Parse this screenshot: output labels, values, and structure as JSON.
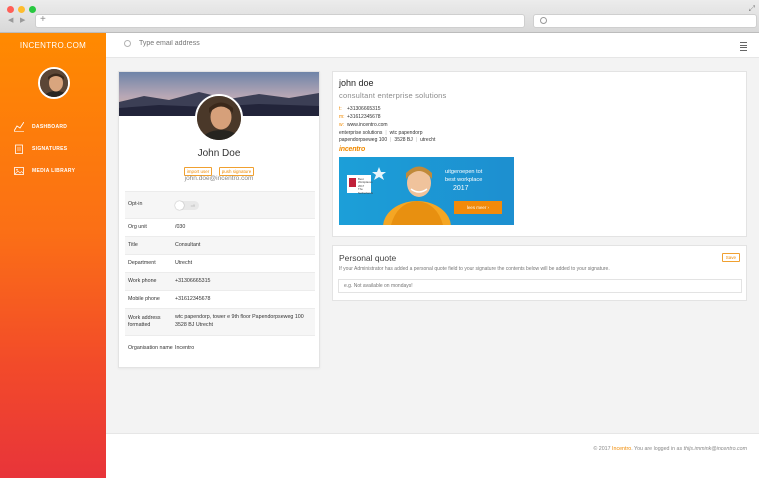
{
  "browser": {
    "back_glyph": "◀",
    "forward_glyph": "▶",
    "new_tab_glyph": "+",
    "expand_glyph": "⤢"
  },
  "sidebar": {
    "brand": "INCENTRO.COM",
    "items": [
      {
        "label": "DASHBOARD",
        "icon": "chart-line-icon"
      },
      {
        "label": "SIGNATURES",
        "icon": "clipboard-icon"
      },
      {
        "label": "MEDIA LIBRARY",
        "icon": "image-icon"
      }
    ],
    "gradient": [
      "#ff8a00",
      "#e8343a"
    ]
  },
  "topbar": {
    "search_placeholder": "Type email address",
    "menu_icon": "list-icon"
  },
  "profile": {
    "name": "John Doe",
    "tags": [
      "import user",
      "push signature"
    ],
    "email": "john.doe@incentro.com",
    "optin_label": "Opt-in",
    "optin_state": "off",
    "fields": [
      {
        "label": "Org unit",
        "value": "/030"
      },
      {
        "label": "Title",
        "value": "Consultant"
      },
      {
        "label": "Department",
        "value": "Utrecht"
      },
      {
        "label": "Work phone",
        "value": "+31306665315"
      },
      {
        "label": "Mobile phone",
        "value": "+31612345678"
      },
      {
        "label": "Work address formatted",
        "value": "wtc papendorp, tower e 9th floor Papendorpseweg 100 3528 BJ Utrecht"
      },
      {
        "label": "Organisation name",
        "value": "Incentro"
      }
    ]
  },
  "signature": {
    "name": "john doe",
    "title": "consultant enterprise solutions",
    "phone_label": "t:",
    "phone": "+31306665315",
    "mobile_label": "m:",
    "mobile": "+31612345678",
    "web_label": "w:",
    "web": "www.incentro.com",
    "address_line1a": "enterprise solutions",
    "address_line1b": "wtc papendorp",
    "address_line2a": "papendorpseweg 100",
    "address_line2b": "3528 BJ",
    "address_line2c": "utrecht",
    "logo_text": "incentro",
    "banner": {
      "badge_line1": "Best",
      "badge_line2": "Workplaces 2017",
      "badge_line3": "The Netherlands",
      "line1": "uitgeroepen tot",
      "line2": "best workplace",
      "line3": "2017",
      "button": "lees meer ›"
    }
  },
  "quote": {
    "title": "Personal quote",
    "description": "If your Administrator has added a personal quote field to your signature the contents below will be added to your signature.",
    "save_label": "Save",
    "placeholder": "e.g. Not available on mondays!"
  },
  "footer": {
    "prefix": "© 2017",
    "brand": "Incentro",
    "middle": ". You are logged in as",
    "user": "thijs.immink@incentro.com"
  },
  "colors": {
    "accent": "#f08a00",
    "sidebar_top": "#ff8a00",
    "sidebar_bottom": "#e8343a",
    "banner_blue": "#1c9fd8"
  }
}
